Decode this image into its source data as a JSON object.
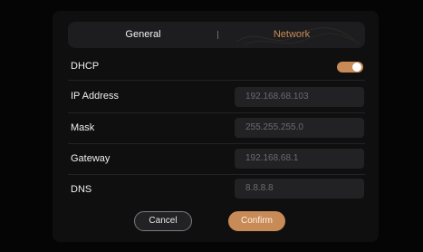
{
  "tabs": [
    {
      "label": "General",
      "active": false
    },
    {
      "label": "Network",
      "active": true
    }
  ],
  "dhcp": {
    "label": "DHCP",
    "enabled": true
  },
  "fields": {
    "ip": {
      "label": "IP Address",
      "value": "192.168.68.103"
    },
    "mask": {
      "label": "Mask",
      "value": "255.255.255.0"
    },
    "gateway": {
      "label": "Gateway",
      "value": "192.168.68.1"
    },
    "dns": {
      "label": "DNS",
      "value": "8.8.8.8"
    }
  },
  "buttons": {
    "cancel": "Cancel",
    "confirm": "Confirm"
  },
  "colors": {
    "accent": "#c88a56",
    "background": "#050505",
    "field": "#222224"
  }
}
